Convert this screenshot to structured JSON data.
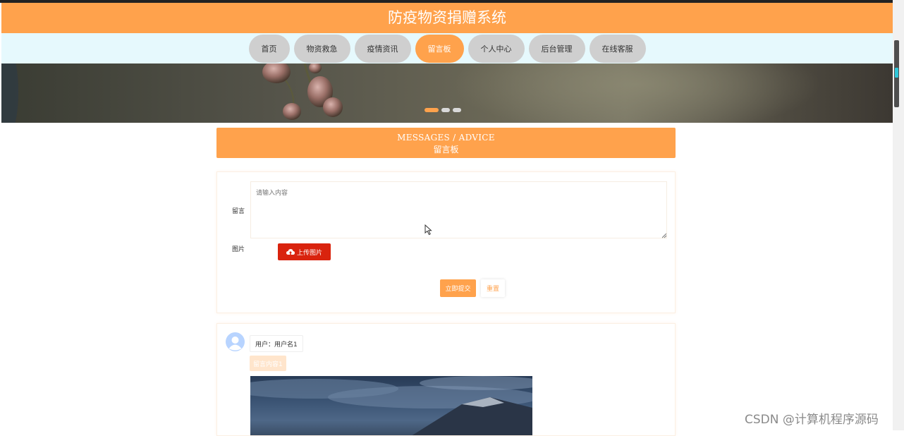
{
  "header": {
    "title": "防疫物资捐赠系统"
  },
  "nav": {
    "items": [
      {
        "label": "首页"
      },
      {
        "label": "物资救急"
      },
      {
        "label": "疫情资讯"
      },
      {
        "label": "留言板"
      },
      {
        "label": "个人中心"
      },
      {
        "label": "后台管理"
      },
      {
        "label": "在线客服"
      }
    ],
    "active_item": "留言板"
  },
  "banner": {
    "slide_count": 3,
    "active_slide": 1
  },
  "section": {
    "title_en": "MESSAGES / ADVICE",
    "title_cn": "留言板"
  },
  "form": {
    "message_label": "留言",
    "message_placeholder": "请输入内容",
    "message_value": "",
    "image_label": "图片",
    "upload_label": "上传图片",
    "upload_icon": "cloud-upload-icon",
    "submit_label": "立即提交",
    "reset_label": "重置"
  },
  "messages": [
    {
      "user": "用户：用户名1",
      "content": "留言内容1",
      "avatar_icon": "user-avatar-icon"
    }
  ],
  "watermark": "CSDN @计算机程序源码",
  "colors": {
    "accent": "#ffa24c",
    "nav_bg": "#e6f9fd",
    "nav_inactive": "#cfcfcf",
    "upload_button": "#d9230e",
    "avatar": "#b8d4ff"
  }
}
